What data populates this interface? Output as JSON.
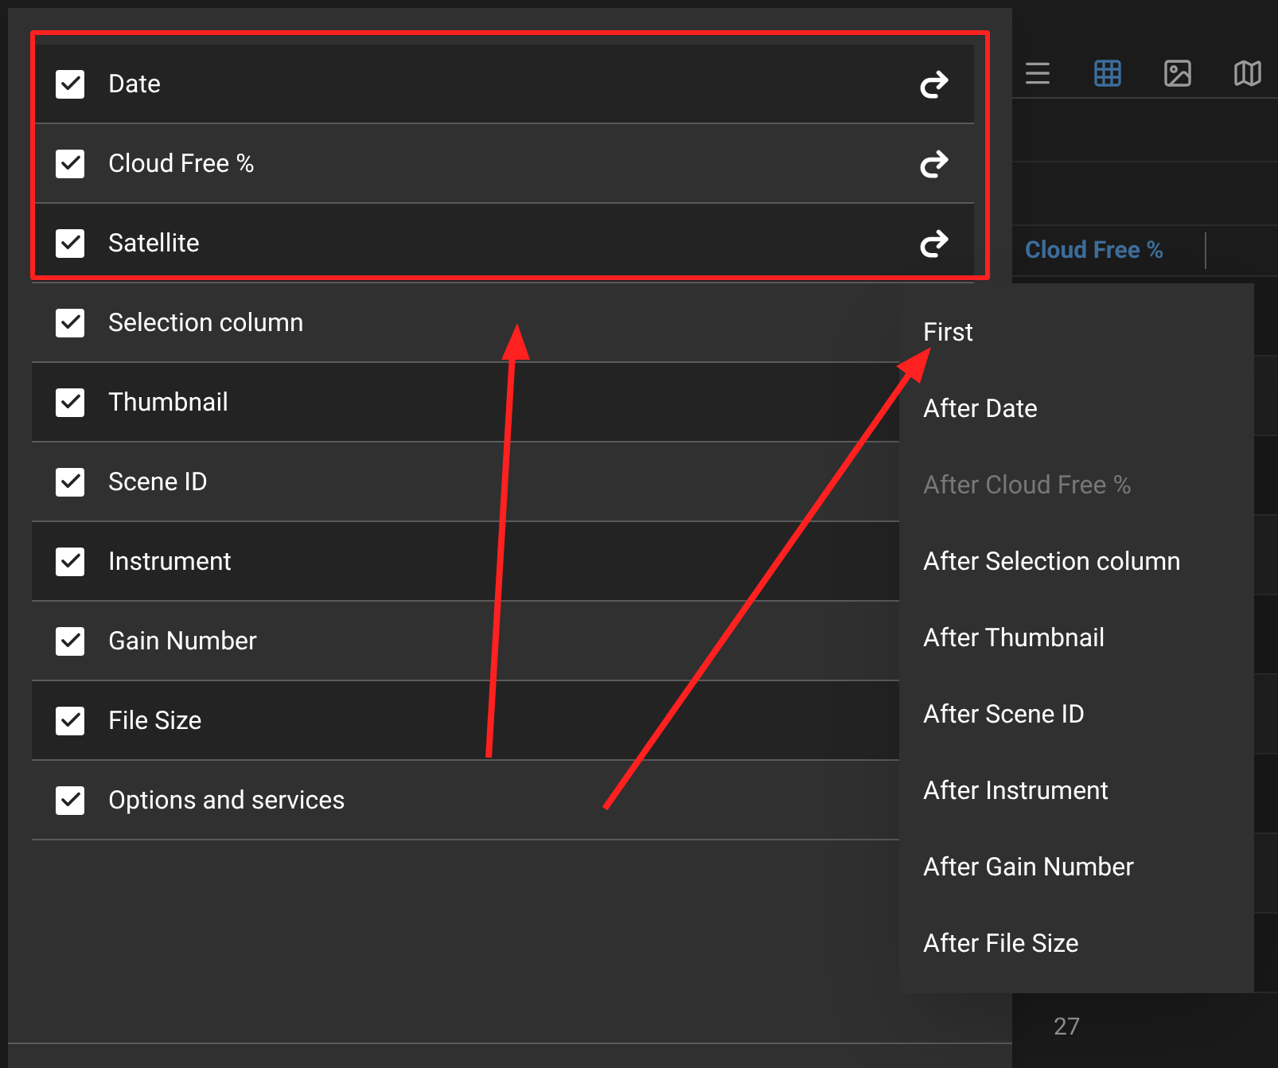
{
  "columns_panel": {
    "columns": [
      {
        "label": "Date",
        "checked": true,
        "movable": true
      },
      {
        "label": "Cloud Free %",
        "checked": true,
        "movable": true
      },
      {
        "label": "Satellite",
        "checked": true,
        "movable": true
      },
      {
        "label": "Selection column",
        "checked": true,
        "movable": false
      },
      {
        "label": "Thumbnail",
        "checked": true,
        "movable": false
      },
      {
        "label": "Scene ID",
        "checked": true,
        "movable": false
      },
      {
        "label": "Instrument",
        "checked": true,
        "movable": false
      },
      {
        "label": "Gain Number",
        "checked": true,
        "movable": false
      },
      {
        "label": "File Size",
        "checked": true,
        "movable": false
      },
      {
        "label": "Options and services",
        "checked": true,
        "movable": false
      }
    ]
  },
  "move_menu": {
    "items": [
      {
        "label": "First",
        "disabled": false
      },
      {
        "label": "After Date",
        "disabled": false
      },
      {
        "label": "After Cloud Free %",
        "disabled": true
      },
      {
        "label": "After Selection column",
        "disabled": false
      },
      {
        "label": "After Thumbnail",
        "disabled": false
      },
      {
        "label": "After Scene ID",
        "disabled": false
      },
      {
        "label": "After Instrument",
        "disabled": false
      },
      {
        "label": "After Gain Number",
        "disabled": false
      },
      {
        "label": "After File Size",
        "disabled": false
      }
    ]
  },
  "background_table": {
    "view_buttons": [
      {
        "kind": "list",
        "selected": false
      },
      {
        "kind": "grid",
        "selected": true
      },
      {
        "kind": "image",
        "selected": false
      },
      {
        "kind": "map",
        "selected": false
      }
    ],
    "column_header": "Cloud Free %",
    "cell": "27"
  }
}
